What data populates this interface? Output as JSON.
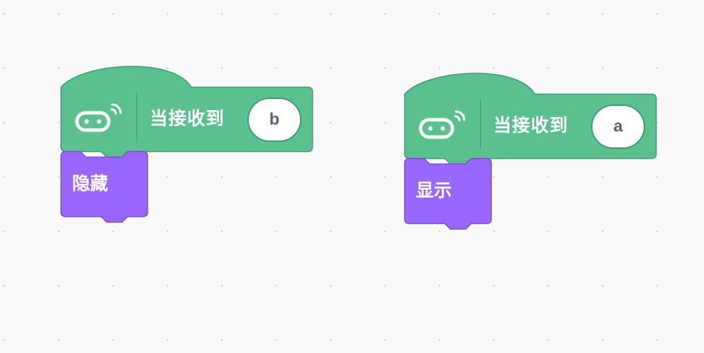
{
  "colors": {
    "event_green": "#59c08e",
    "event_border": "#3d9a75",
    "looks_purple": "#9966ff",
    "looks_border": "#774dcb",
    "field_text": "#575e75",
    "canvas_bg": "#f9f9f9"
  },
  "scripts": [
    {
      "hat": {
        "icon": "robot-wireless-icon",
        "label": "当接收到",
        "key_value": "b"
      },
      "stack": {
        "label": "隐藏"
      }
    },
    {
      "hat": {
        "icon": "robot-wireless-icon",
        "label": "当接收到",
        "key_value": "a"
      },
      "stack": {
        "label": "显示"
      }
    }
  ]
}
